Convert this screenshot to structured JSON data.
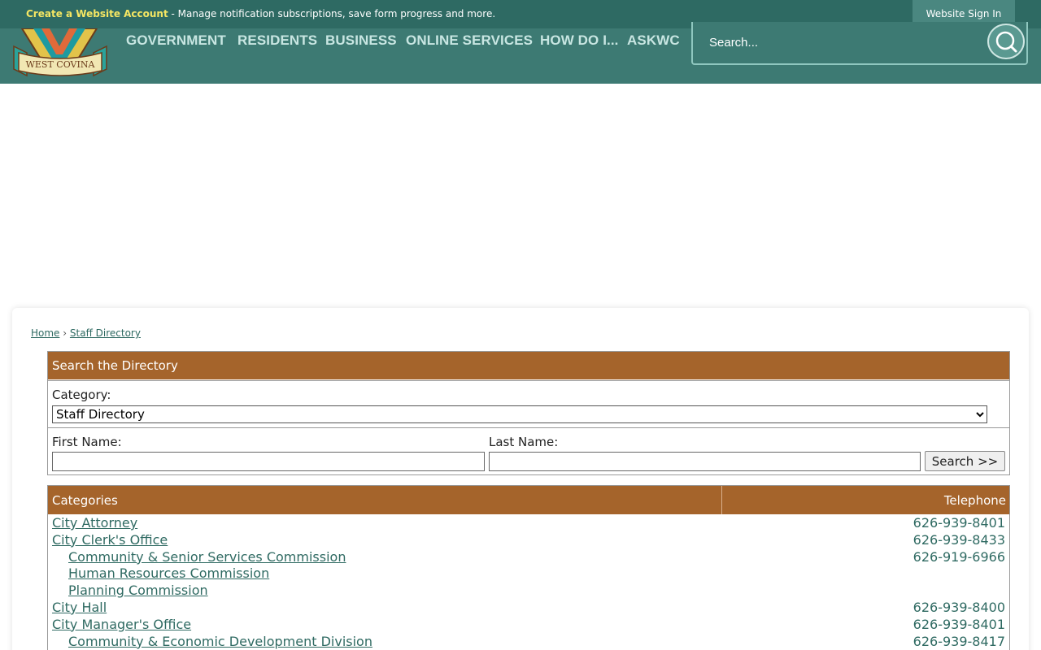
{
  "topbar": {
    "promo_link": "Create a Website Account",
    "promo_text": " - Manage notification subscriptions, save form progress and more.",
    "signin": "Website Sign In"
  },
  "logo": {
    "text": "WEST COVINA"
  },
  "nav": [
    {
      "label": "GOVERNMENT"
    },
    {
      "label": "RESIDENTS"
    },
    {
      "label": "BUSINESS"
    },
    {
      "label": "ONLINE SERVICES"
    },
    {
      "label": "HOW DO I..."
    },
    {
      "label": "ASKWC"
    }
  ],
  "search": {
    "placeholder": "Search..."
  },
  "breadcrumb": {
    "home": "Home",
    "sep": "›",
    "current": "Staff Directory"
  },
  "directory": {
    "title": "Search the Directory",
    "category_label": "Category:",
    "category_value": "Staff Directory",
    "first_name_label": "First Name:",
    "last_name_label": "Last Name:",
    "search_button": "Search >>"
  },
  "categories": {
    "col_categories": "Categories",
    "col_telephone": "Telephone",
    "items": [
      {
        "name": "City Attorney",
        "phone": "626-939-8401",
        "indent": false
      },
      {
        "name": "City Clerk's Office",
        "phone": "626-939-8433",
        "indent": false
      },
      {
        "name": "Community & Senior Services Commission",
        "phone": "626-919-6966",
        "indent": true
      },
      {
        "name": "Human Resources Commission",
        "phone": "",
        "indent": true
      },
      {
        "name": "Planning Commission",
        "phone": "",
        "indent": true
      },
      {
        "name": "City Hall",
        "phone": "626-939-8400",
        "indent": false
      },
      {
        "name": "City Manager's Office",
        "phone": "626-939-8401",
        "indent": false
      },
      {
        "name": "Community & Economic Development Division",
        "phone": "626-939-8417",
        "indent": true
      }
    ]
  },
  "colors": {
    "header": "#3d7a73",
    "topbar": "#2e6a63",
    "accent_brown": "#a5642b",
    "link": "#2f6a62"
  }
}
